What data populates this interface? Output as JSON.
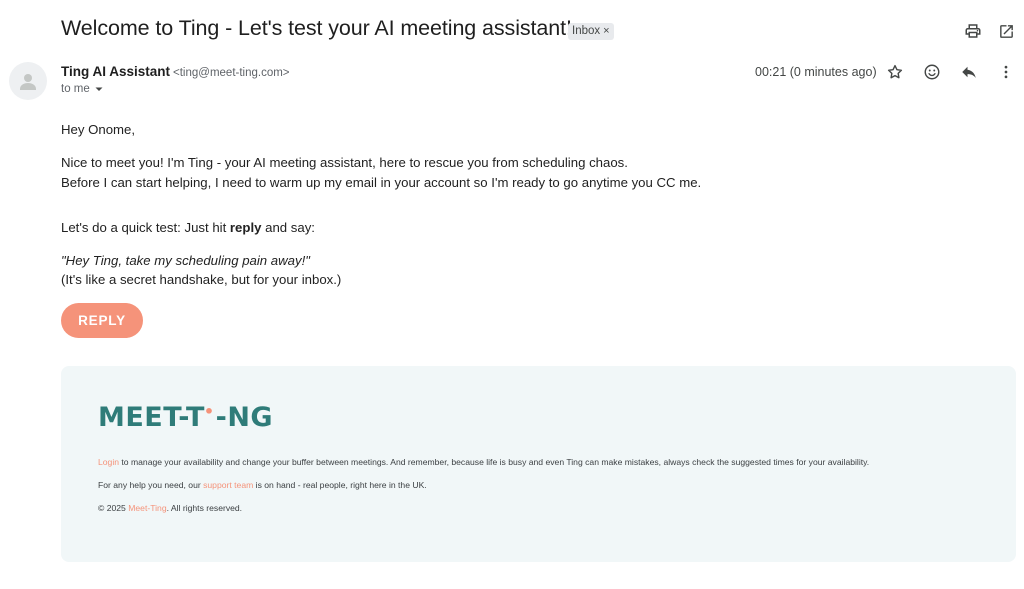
{
  "email": {
    "subject": "Welcome to Ting - Let's test your AI meeting assistant!",
    "label_chip": "Inbox",
    "label_close": "×",
    "sender_name": "Ting AI Assistant",
    "sender_email": "<ting@meet-ting.com>",
    "recipient": "to me",
    "timestamp": "00:21 (0 minutes ago)"
  },
  "message": {
    "greeting": "Hey Onome,",
    "line1": "Nice to meet you! I'm Ting - your AI meeting assistant, here to rescue you from scheduling chaos.",
    "line2": "Before I can start helping, I need to warm up my email in your account so I'm ready to go anytime you CC me.",
    "test_prefix": "Let's do a quick test: Just hit ",
    "test_bold": "reply",
    "test_suffix": " and say:",
    "quote": "\"Hey Ting, take my scheduling pain away!\"",
    "aside": "(It's like a secret handshake, but for your inbox.)",
    "reply_button": "REPLY"
  },
  "footer": {
    "logo_left": "MEET-T",
    "logo_dot": "•",
    "logo_right": "-NG",
    "login_link": "Login",
    "login_text": " to manage your availability and change your buffer between meetings. And remember, because life is busy and even Ting can make mistakes, always check the suggested times for your availability.",
    "help_prefix": "For any help you need, our ",
    "support_link": "support team",
    "help_suffix": " is on hand - real people, right here in the UK.",
    "copyright_prefix": "© 2025 ",
    "copyright_link": "Meet-Ting",
    "copyright_suffix": ". All rights reserved."
  },
  "icons": [
    "print-icon",
    "open-in-new-window-icon",
    "star-icon",
    "emoji-react-icon",
    "reply-arrow-icon",
    "more-vertical-icon",
    "chevron-down-icon",
    "avatar-person-icon"
  ],
  "colors": {
    "accent": "#f5937a",
    "brand_teal": "#2f7c79",
    "footer_bg": "#f1f7f8"
  }
}
